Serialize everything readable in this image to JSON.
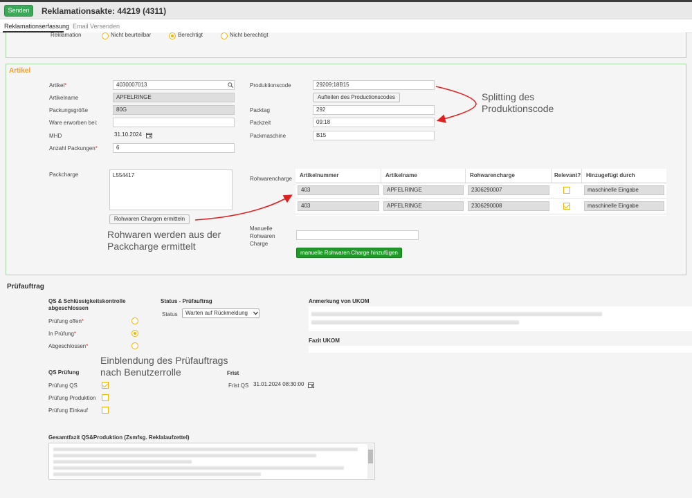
{
  "header": {
    "send_label": "Senden",
    "title": "Reklamationsakte: 44219 (4311)"
  },
  "tabs": [
    {
      "label": "Reklamationserfassung",
      "active": true
    },
    {
      "label": "Email Versenden",
      "active": false
    }
  ],
  "top_section": {
    "label": "Reklamation",
    "options": [
      {
        "label": "Nicht beurteilbar",
        "selected": false
      },
      {
        "label": "Berechtigt",
        "selected": true
      },
      {
        "label": "Nicht berechtigt",
        "selected": false
      }
    ]
  },
  "artikel": {
    "title": "Artikel",
    "artikel_label": "Artikel",
    "artikel_value": "4030007013",
    "artikelname_label": "Artikelname",
    "artikelname_value": "APFELRINGE",
    "packungsgroesse_label": "Packungsgröße",
    "packungsgroesse_value": "80G",
    "ware_label": "Ware erworben bei:",
    "ware_value": "",
    "mhd_label": "MHD",
    "mhd_value": "31.10.2024",
    "anzahl_label": "Anzahl Packungen",
    "anzahl_value": "6",
    "produktionscode_label": "Produktionscode",
    "produktionscode_value": "29209:18B15",
    "aufteilen_label": "Aufteilen des Productionscodes",
    "packtag_label": "Packtag",
    "packtag_value": "292",
    "packzeit_label": "Packzeit",
    "packzeit_value": "09:18",
    "packmaschine_label": "Packmaschine",
    "packmaschine_value": "B15",
    "packcharge_label": "Packcharge",
    "packcharge_value": "L554417",
    "rohwaren_btn_label": "Rohwaren Chargen ermitteln",
    "rohwarencharge_label": "Rohwarencharge",
    "manuelle_label": "Manuelle\nRohwaren\nCharge",
    "manuelle_value": "",
    "manuelle_btn_label": "manuelle Rohwaren Charge hinzufügen"
  },
  "rohwaren_table": {
    "columns": [
      "Artikelnummer",
      "Artikelname",
      "Rohwarencharge",
      "Relevant?",
      "Hinzugefügt durch"
    ],
    "rows": [
      {
        "artikelnummer": "403",
        "artikelname": "APFELRINGE",
        "rohwarencharge": "2306290007",
        "relevant": false,
        "hinzugefuegt": "maschinelle Eingabe"
      },
      {
        "artikelnummer": "403",
        "artikelname": "APFELRINGE",
        "rohwarencharge": "2306290008",
        "relevant": true,
        "hinzugefuegt": "maschinelle Eingabe"
      }
    ]
  },
  "annotations": {
    "splitting": "Splitting des\nProduktionscode",
    "rohwaren": "Rohwaren werden aus der\nPackcharge ermittelt",
    "einblendung": "Einblendung des Prüfauftrags\nnach Benutzerrolle"
  },
  "pruefauftrag": {
    "title": "Prüfauftrag",
    "qs_title": "QS & Schlüssigkeitskontrolle\nabgeschlossen",
    "options": [
      {
        "label": "Prüfung offen",
        "selected": false
      },
      {
        "label": "In Prüfung",
        "selected": true
      },
      {
        "label": "Abgeschlossen",
        "selected": false
      }
    ],
    "status_section_title": "Status - Prüfauftrag",
    "status_label": "Status",
    "status_value": "Warten auf Rückmeldung",
    "anmerkung_title": "Anmerkung von UKOM",
    "fazit_title": "Fazit UKOM",
    "qs_pruefung_title": "QS Prüfung",
    "checks": [
      {
        "label": "Prüfung QS",
        "checked": true
      },
      {
        "label": "Prüfung Produktion",
        "checked": false
      },
      {
        "label": "Prüfung Einkauf",
        "checked": false
      }
    ],
    "frist_title": "Frist",
    "frist_qs_label": "Frist QS",
    "frist_qs_value": "31.01.2024 08:30:00",
    "gesamtfazit_title": "Gesamtfazit QS&Produktion (Zsmfsg. Reklalaufzettel)"
  },
  "colors": {
    "accent_orange": "#f0a030",
    "send_green": "#3aa856",
    "button_green": "#1f9a28",
    "annotation_red": "#e02020",
    "panel_border": "#a8d5a8"
  }
}
